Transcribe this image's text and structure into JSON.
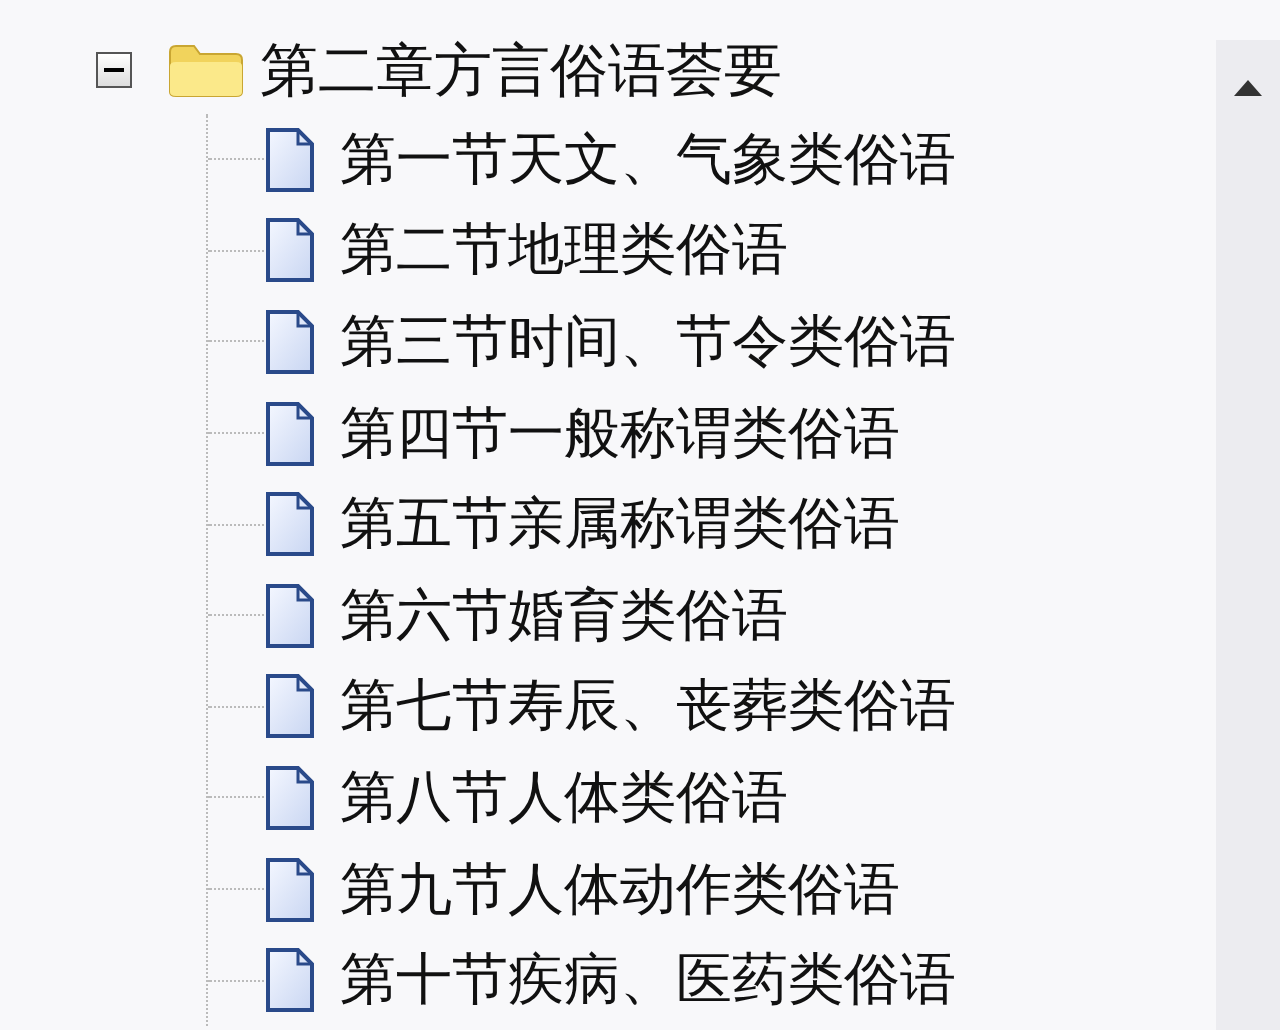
{
  "tree": {
    "label": "第二章方言俗语荟要",
    "expanded": true,
    "children": [
      {
        "label": "第一节天文、气象类俗语"
      },
      {
        "label": "第二节地理类俗语"
      },
      {
        "label": "第三节时间、节令类俗语"
      },
      {
        "label": "第四节一般称谓类俗语"
      },
      {
        "label": "第五节亲属称谓类俗语"
      },
      {
        "label": "第六节婚育类俗语"
      },
      {
        "label": "第七节寿辰、丧葬类俗语"
      },
      {
        "label": "第八节人体类俗语"
      },
      {
        "label": "第九节人体动作类俗语"
      },
      {
        "label": "第十节疾病、医药类俗语"
      }
    ]
  }
}
